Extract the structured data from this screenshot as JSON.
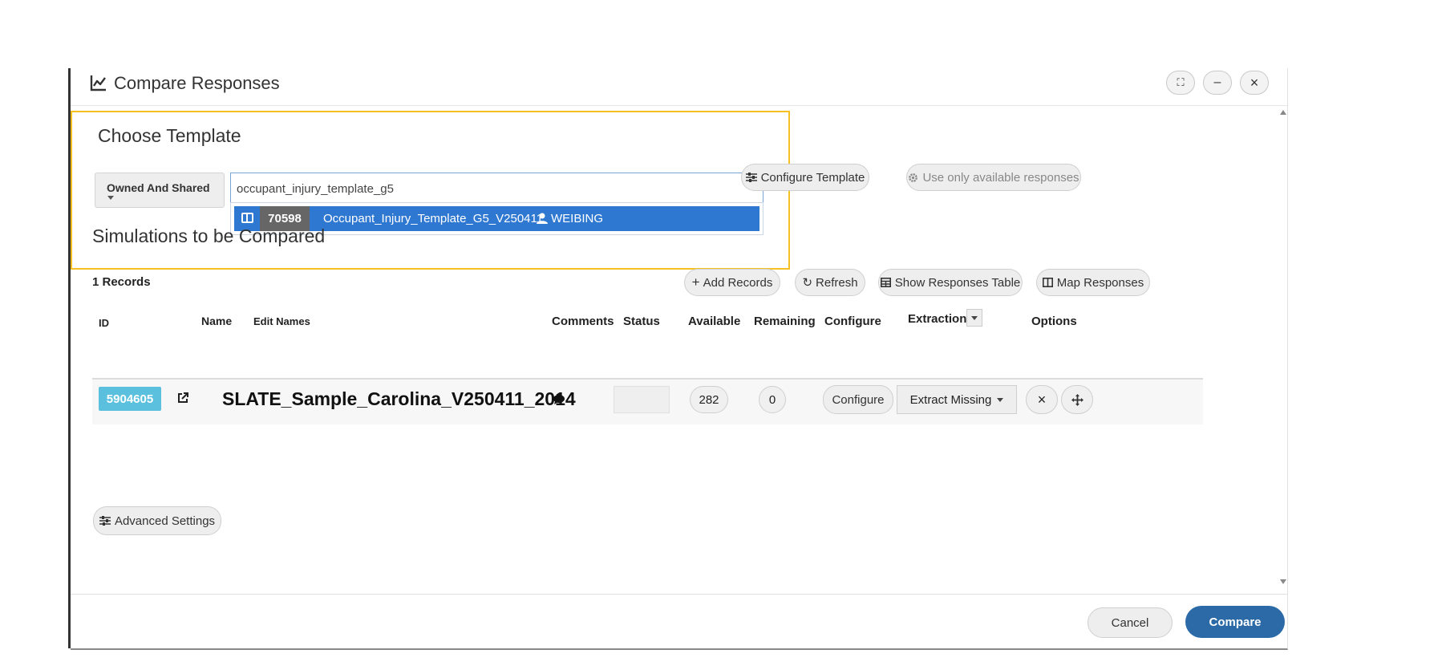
{
  "window": {
    "title": "Compare Responses",
    "controls": {
      "maximize": "⛶",
      "minimize": "–",
      "close": "×"
    }
  },
  "template": {
    "heading": "Choose Template",
    "filter_label": "Owned And Shared",
    "search_value": "occupant_injury_template_g5",
    "suggestion": {
      "id": "70598",
      "name": "Occupant_Injury_Template_G5_V250411",
      "owner": "WEIBING"
    },
    "configure_label": "Configure Template",
    "available_only_label": "Use only available responses"
  },
  "simulations": {
    "heading": "Simulations to be Compared",
    "records_count": "1 Records",
    "actions": {
      "add": "Add Records",
      "refresh": "Refresh",
      "show_table": "Show Responses Table",
      "map": "Map Responses"
    },
    "columns": {
      "id": "ID",
      "name": "Name",
      "edit_names": "Edit Names",
      "comments": "Comments",
      "status": "Status",
      "available": "Available",
      "remaining": "Remaining",
      "configure": "Configure",
      "extraction": "Extraction",
      "options": "Options"
    },
    "rows": [
      {
        "id": "5904605",
        "name": "SLATE_Sample_Carolina_V250411_2014",
        "status": "",
        "available": "282",
        "remaining": "0",
        "configure_label": "Configure",
        "extract_label": "Extract Missing"
      }
    ]
  },
  "advanced_label": "Advanced Settings",
  "footer": {
    "cancel": "Cancel",
    "compare": "Compare"
  },
  "colors": {
    "primary": "#2b6aa6",
    "highlight": "#f5c022",
    "selection": "#2f78d2",
    "id_badge": "#5bc0de"
  }
}
